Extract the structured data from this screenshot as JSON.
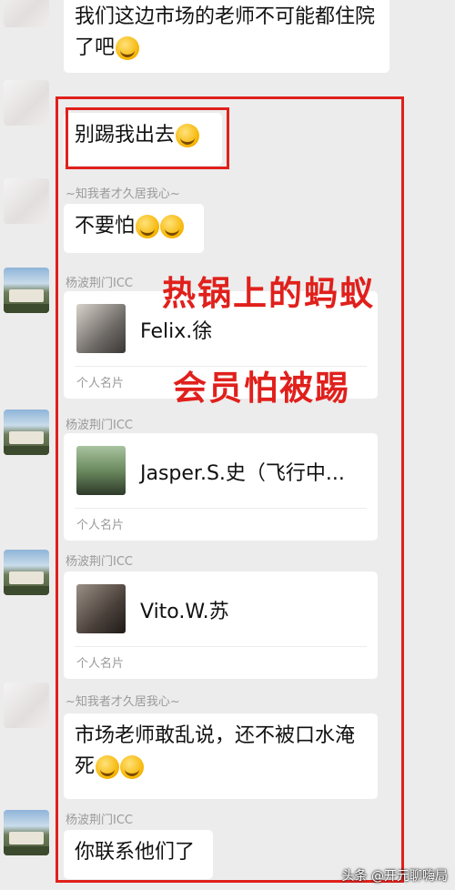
{
  "messages": [
    {
      "text": "我们这边市场的老师不可能都住院了吧"
    },
    {
      "text": "别踢我出去"
    },
    {
      "sender": "~知我者才久居我心~",
      "text": "不要怕"
    },
    {
      "sender": "杨波荆门ICC",
      "card_name": "Felix.徐",
      "card_type": "个人名片"
    },
    {
      "sender": "杨波荆门ICC",
      "card_name": "Jasper.S.史（飞行中...",
      "card_type": "个人名片"
    },
    {
      "sender": "杨波荆门ICC",
      "card_name": "Vito.W.苏",
      "card_type": "个人名片"
    },
    {
      "sender": "~知我者才久居我心~",
      "text": "市场老师敢乱说，还不被口水淹死"
    },
    {
      "sender": "杨波荆门ICC",
      "text": "你联系他们了"
    }
  ],
  "annotations": {
    "line1": "热锅上的蚂蚁",
    "line2": "会员怕被踢"
  },
  "watermark": "头条 @开元聊嗨局",
  "colors": {
    "annotation_red": "#e0201c",
    "background": "#ececec",
    "bubble": "#ffffff"
  },
  "icons": {
    "emoji": "facepalm-emoji"
  }
}
